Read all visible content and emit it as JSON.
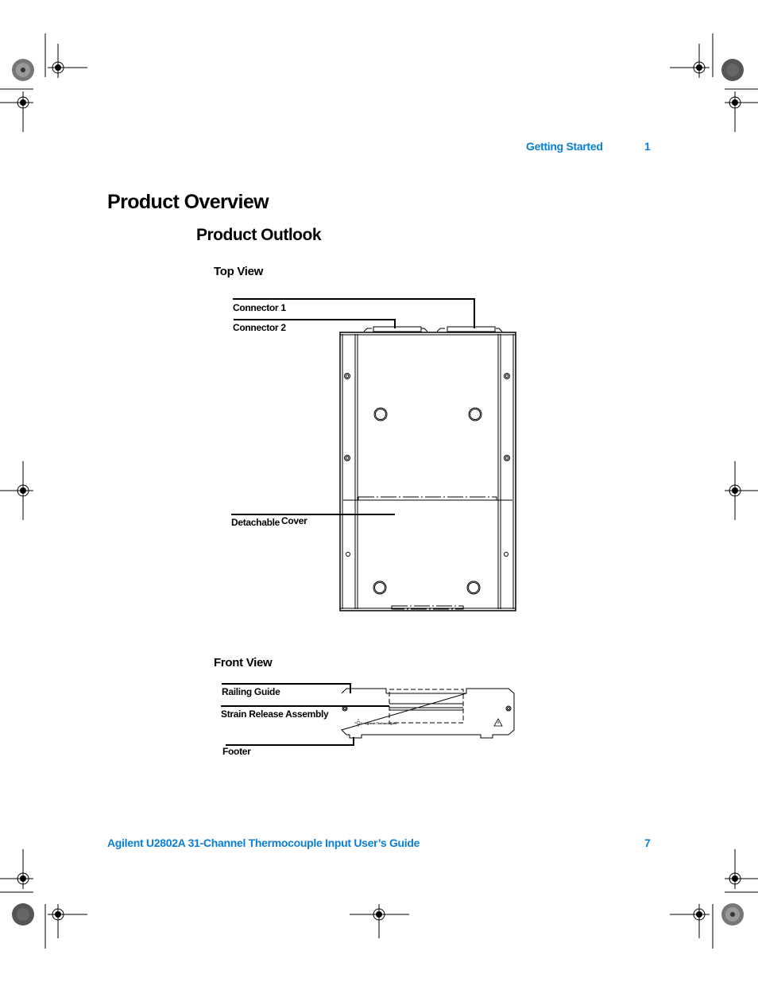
{
  "header": {
    "section": "Getting Started",
    "chapter": "1"
  },
  "title": "Product Overview",
  "subtitle": "Product Outlook",
  "top_view": {
    "heading": "Top View",
    "callouts": {
      "connector1": "Connector 1",
      "connector2": "Connector 2",
      "detachable": "Detachable",
      "cover": "Cover"
    }
  },
  "front_view": {
    "heading": "Front View",
    "callouts": {
      "railing": "Railing Guide",
      "strain": "Strain Release Assembly",
      "footer": "Footer"
    },
    "brand": "Agilent Technologies"
  },
  "footer": {
    "guide_title": "Agilent U2802A 31-Channel Thermocouple Input User’s Guide",
    "page_number": "7"
  },
  "colors": {
    "accent": "#0a7fd0"
  }
}
